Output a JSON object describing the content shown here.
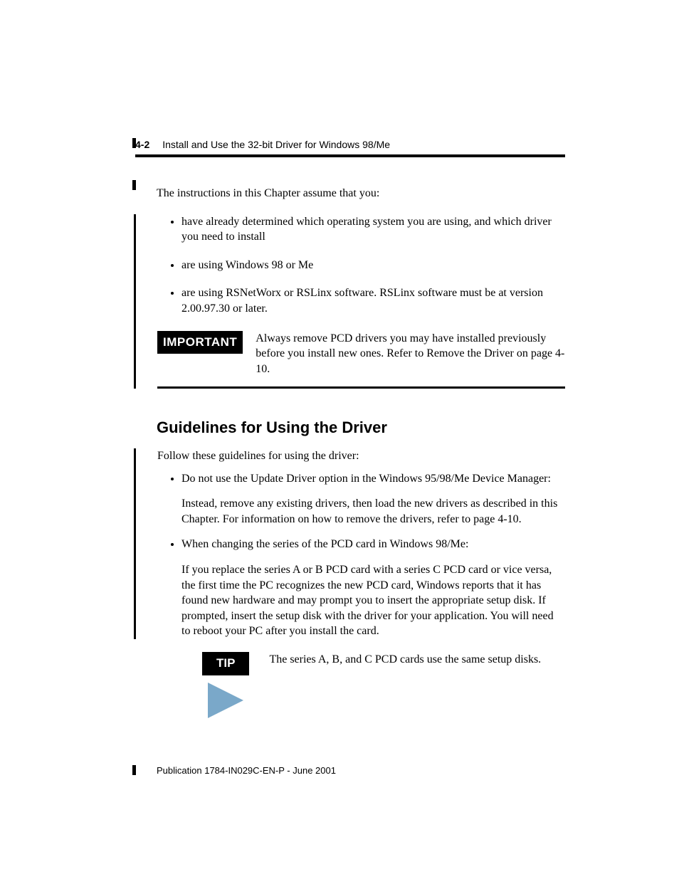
{
  "header": {
    "page_number": "4-2",
    "running_title": "Install and Use the 32-bit Driver for Windows 98/Me"
  },
  "intro": "The instructions in this Chapter assume that you:",
  "assumptions": [
    "have already determined which operating system you are using, and which driver you need to install",
    "are using Windows 98 or Me",
    "are using RSNetWorx or RSLinx software. RSLinx software must be at version 2.00.97.30 or later."
  ],
  "important": {
    "label": "IMPORTANT",
    "text": "Always remove PCD drivers you may have installed previously before you install new ones. Refer to Remove the Driver on page 4-10."
  },
  "section_heading": "Guidelines for Using the Driver",
  "follow_text": "Follow these guidelines for using the driver:",
  "guidelines": [
    {
      "lead": "Do not use the Update Driver option in the Windows 95/98/Me Device Manager:",
      "detail": "Instead, remove any existing drivers, then load the new drivers as described in this Chapter. For information on how to remove the drivers, refer to page 4-10."
    },
    {
      "lead": "When changing the series of the PCD card in Windows 98/Me:",
      "detail": "If you replace the series A or B PCD card with a series C PCD card or vice versa, the first time the PC recognizes the new PCD card, Windows reports that it has found new hardware and may prompt you to insert the appropriate setup disk. If prompted, insert the setup disk with the driver for your application. You will need to reboot your PC after you install the card."
    }
  ],
  "tip": {
    "label": "TIP",
    "text": "The series A, B, and C PCD cards use the same setup disks."
  },
  "footer": "Publication 1784-IN029C-EN-P - June 2001"
}
